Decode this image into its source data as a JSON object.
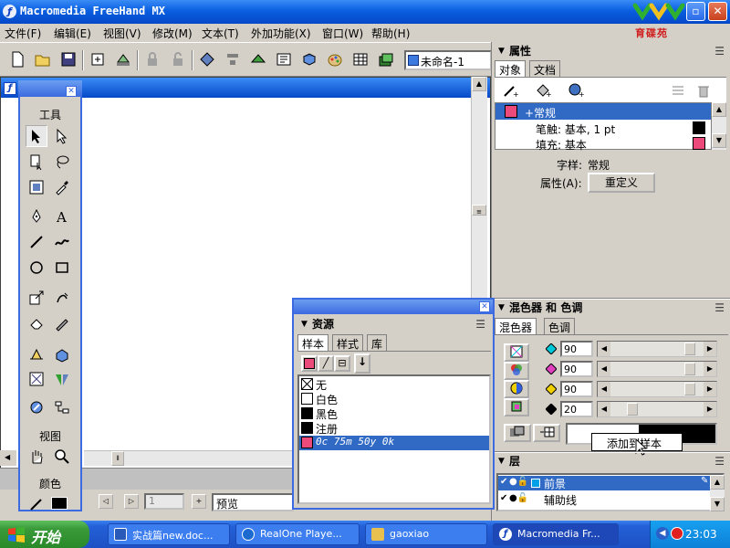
{
  "app": {
    "title": "Macromedia FreeHand MX",
    "logo_text": "育碟苑",
    "document_name": "未命名-1"
  },
  "menu": [
    "文件(F)",
    "编辑(E)",
    "视图(V)",
    "修改(M)",
    "文本(T)",
    "外加功能(X)",
    "窗口(W)",
    "帮助(H)"
  ],
  "tools_panel": {
    "tools_label": "工具",
    "view_label": "视图",
    "color_label": "颜色"
  },
  "properties_panel": {
    "title": "属性",
    "tabs": [
      "对象",
      "文档"
    ],
    "items": [
      {
        "label": "+常规",
        "type": "group",
        "selected": true
      },
      {
        "label": "笔触: 基本, 1 pt",
        "type": "stroke"
      },
      {
        "label": "填充: 基本",
        "type": "fill"
      }
    ],
    "style_label": "字样:",
    "style_value": "常规",
    "attr_label": "属性(A):",
    "redefine_button": "重定义"
  },
  "mixer_panel": {
    "title": "混色器 和 色调",
    "tabs": [
      "混色器",
      "色调"
    ],
    "sliders": [
      {
        "channel": "cyan",
        "value": "90",
        "fill": 0.9,
        "color": "#00c8d8"
      },
      {
        "channel": "magenta",
        "value": "90",
        "fill": 0.9,
        "color": "#e040c0"
      },
      {
        "channel": "yellow",
        "value": "90",
        "fill": 0.9,
        "color": "#f0d000"
      },
      {
        "channel": "black",
        "value": "20",
        "fill": 0.2,
        "color": "#000000"
      }
    ],
    "tooltip": "添加到样本"
  },
  "layers_panel": {
    "title": "层",
    "layers": [
      {
        "name": "前景",
        "selected": true
      },
      {
        "name": "辅助线",
        "selected": false
      }
    ]
  },
  "assets_panel": {
    "title": "资源",
    "tabs": [
      "样本",
      "样式",
      "库"
    ],
    "swatches": [
      {
        "name": "无",
        "color": "none"
      },
      {
        "name": "白色",
        "color": "#ffffff"
      },
      {
        "name": "黑色",
        "color": "#000000"
      },
      {
        "name": "注册",
        "color": "#000000"
      },
      {
        "name": "0c 75m 50y 0k",
        "color": "#ec4a7a",
        "selected": true
      }
    ]
  },
  "statusbar": {
    "preview": "预览",
    "page": "1"
  },
  "taskbar": {
    "start": "开始",
    "tasks": [
      {
        "label": "实战篇new.doc...",
        "color": "#2a5ab8"
      },
      {
        "label": "RealOne Playe...",
        "color": "#1c6ad0"
      },
      {
        "label": "gaoxiao",
        "color": "#e8c050"
      },
      {
        "label": "Macromedia Fr...",
        "color": "#3c78d8",
        "active": true
      }
    ],
    "clock": "23:03"
  },
  "colors": {
    "accent_pink": "#ec4a7a",
    "xp_blue": "#0548c8"
  }
}
